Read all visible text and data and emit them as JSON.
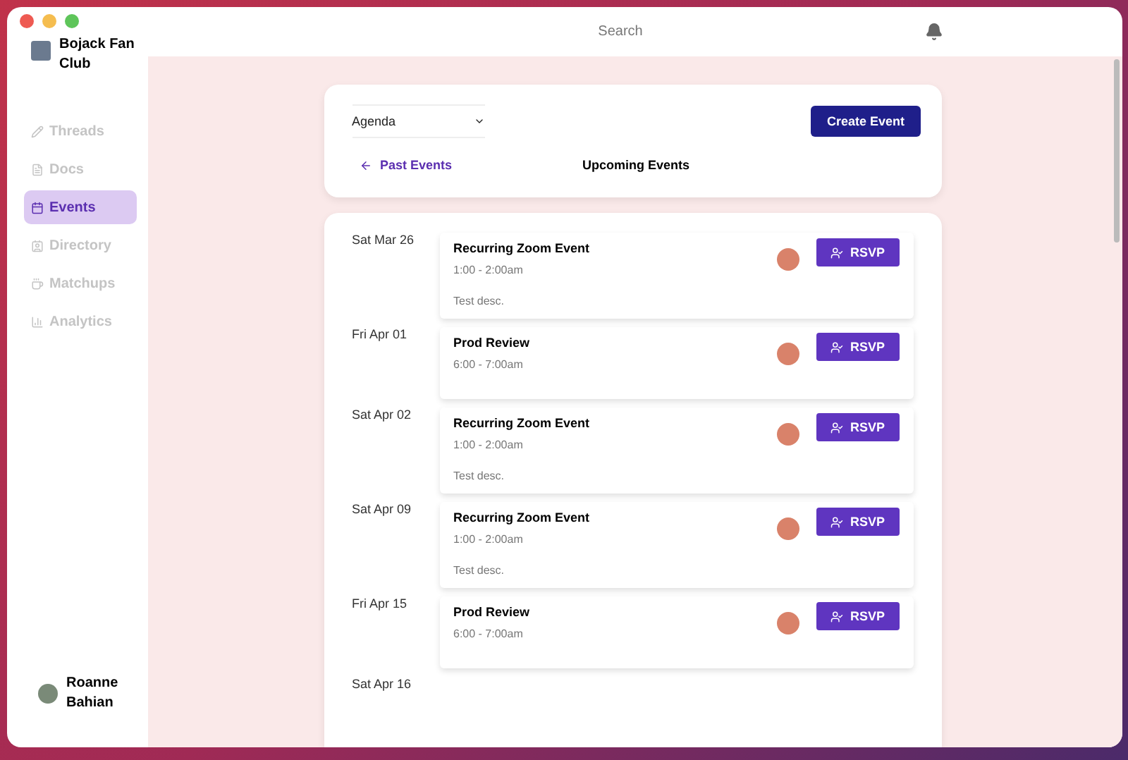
{
  "window": {
    "search": {
      "placeholder": "Search"
    }
  },
  "sidebar": {
    "workspace": "Bojack Fan Club",
    "items": [
      {
        "label": "Threads",
        "selected": false
      },
      {
        "label": "Docs",
        "selected": false
      },
      {
        "label": "Events",
        "selected": true
      },
      {
        "label": "Directory",
        "selected": false
      },
      {
        "label": "Matchups",
        "selected": false
      },
      {
        "label": "Analytics",
        "selected": false
      }
    ],
    "user": "Roanne Bahian"
  },
  "header": {
    "view_select": "Agenda",
    "create_button": "Create Event",
    "past_link": "Past Events",
    "heading": "Upcoming Events"
  },
  "events": [
    {
      "date": "Sat Mar 26",
      "title": "Recurring Zoom Event",
      "time": "1:00 - 2:00am",
      "description": "Test desc.",
      "button": "RSVP"
    },
    {
      "date": "Fri Apr 01",
      "title": "Prod Review",
      "time": "6:00 - 7:00am",
      "button": "RSVP"
    },
    {
      "date": "Sat Apr 02",
      "title": "Recurring Zoom Event",
      "time": "1:00 - 2:00am",
      "description": "Test desc.",
      "button": "RSVP"
    },
    {
      "date": "Sat Apr 09",
      "title": "Recurring Zoom Event",
      "time": "1:00 - 2:00am",
      "description": "Test desc.",
      "button": "RSVP"
    },
    {
      "date": "Fri Apr 15",
      "title": "Prod Review",
      "time": "6:00 - 7:00am",
      "button": "RSVP"
    },
    {
      "date": "Sat Apr 16"
    }
  ]
}
